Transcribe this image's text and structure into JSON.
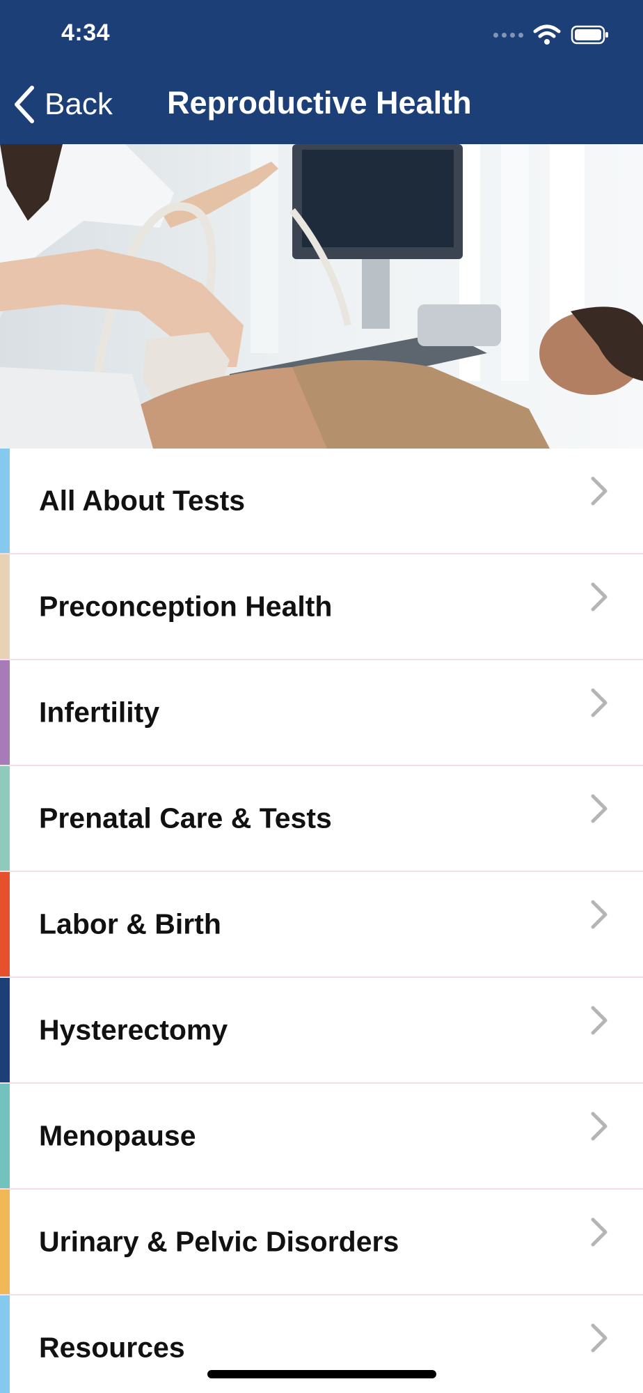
{
  "status_bar": {
    "time": "4:34"
  },
  "nav": {
    "back_label": "Back",
    "title": "Reproductive Health"
  },
  "hero": {
    "image": "ultrasound-exam-photo"
  },
  "menu": {
    "items": [
      {
        "label": "All About Tests",
        "color": "#86c9ef"
      },
      {
        "label": "Preconception Health",
        "color": "#e6d2b5"
      },
      {
        "label": "Infertility",
        "color": "#a77bb8"
      },
      {
        "label": "Prenatal Care & Tests",
        "color": "#8fcbbd"
      },
      {
        "label": "Labor & Birth",
        "color": "#e7502d"
      },
      {
        "label": "Hysterectomy",
        "color": "#1c3f78"
      },
      {
        "label": "Menopause",
        "color": "#72c2bd"
      },
      {
        "label": "Urinary & Pelvic Disorders",
        "color": "#f0b857"
      },
      {
        "label": "Resources",
        "color": "#86c9ef"
      }
    ]
  },
  "colors": {
    "nav_background": "#1c3f78",
    "divider": "#f6dfe4",
    "chevron": "#b5b5b8"
  }
}
